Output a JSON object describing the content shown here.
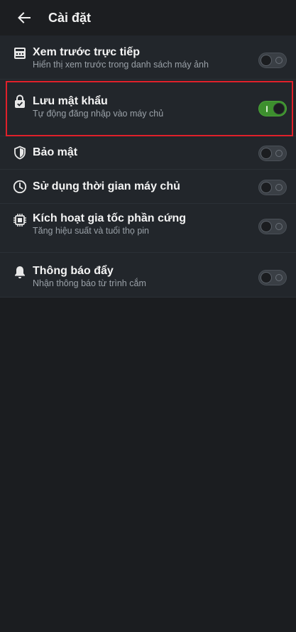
{
  "header": {
    "title": "Cài đặt",
    "back_icon": "arrow-left-icon"
  },
  "settings": [
    {
      "id": "live-preview",
      "icon": "preview-list-icon",
      "title": "Xem trước trực tiếp",
      "subtitle": "Hiển thị xem trước trong danh sách máy ảnh",
      "enabled": false
    },
    {
      "id": "save-password",
      "icon": "lock-icon",
      "title": "Lưu mật khẩu",
      "subtitle": "Tự động đăng nhập vào máy chủ",
      "enabled": true
    },
    {
      "id": "security",
      "icon": "shield-icon",
      "title": "Bảo mật",
      "subtitle": "",
      "enabled": false
    },
    {
      "id": "server-time",
      "icon": "clock-icon",
      "title": "Sử dụng thời gian máy chủ",
      "subtitle": "",
      "enabled": false
    },
    {
      "id": "hardware-acceleration",
      "icon": "chip-icon",
      "title": "Kích hoạt gia tốc phần cứng",
      "subtitle": "Tăng hiệu suất và tuổi thọ pin",
      "enabled": false
    },
    {
      "id": "push-notifications",
      "icon": "bell-icon",
      "title": "Thông báo đẩy",
      "subtitle": "Nhận thông báo từ trình cắm",
      "enabled": false
    }
  ],
  "colors": {
    "background": "#1b1d20",
    "row_background": "#22262b",
    "toggle_on": "#3d8f2e",
    "highlight_border": "#e0202a"
  }
}
